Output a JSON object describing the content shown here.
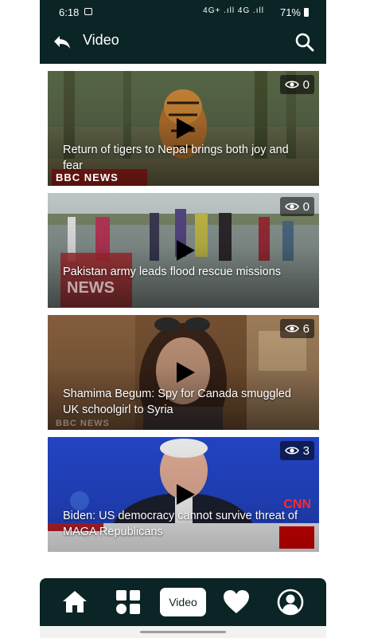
{
  "status_bar": {
    "time": "6:18",
    "network_text": "4G+ .ıll 4G .ıll",
    "battery": "71%"
  },
  "app_bar": {
    "title": "Video",
    "back_icon": "reply-back-icon",
    "search_icon": "search-icon"
  },
  "videos": [
    {
      "title": "Return of tigers to Nepal brings both joy and fear",
      "views": "0",
      "watermark": "BBC NEWS"
    },
    {
      "title": "Pakistan army leads flood rescue missions",
      "views": "0",
      "watermark": "NEWS"
    },
    {
      "title": "Shamima Begum: Spy for Canada smuggled UK schoolgirl to Syria",
      "views": "6",
      "watermark": "BBC NEWS"
    },
    {
      "title": "Biden: US democracy cannot survive threat of MAGA Republicans",
      "views": "3",
      "watermark": "CNN"
    }
  ],
  "bottom_nav": {
    "home_icon": "home-icon",
    "grid_icon": "grid-icon",
    "video_label": "Video",
    "heart_icon": "heart-icon",
    "profile_icon": "profile-icon",
    "active": "Video"
  },
  "colors": {
    "bar_bg": "#0b2426",
    "text_on_bar": "#ffffff"
  }
}
